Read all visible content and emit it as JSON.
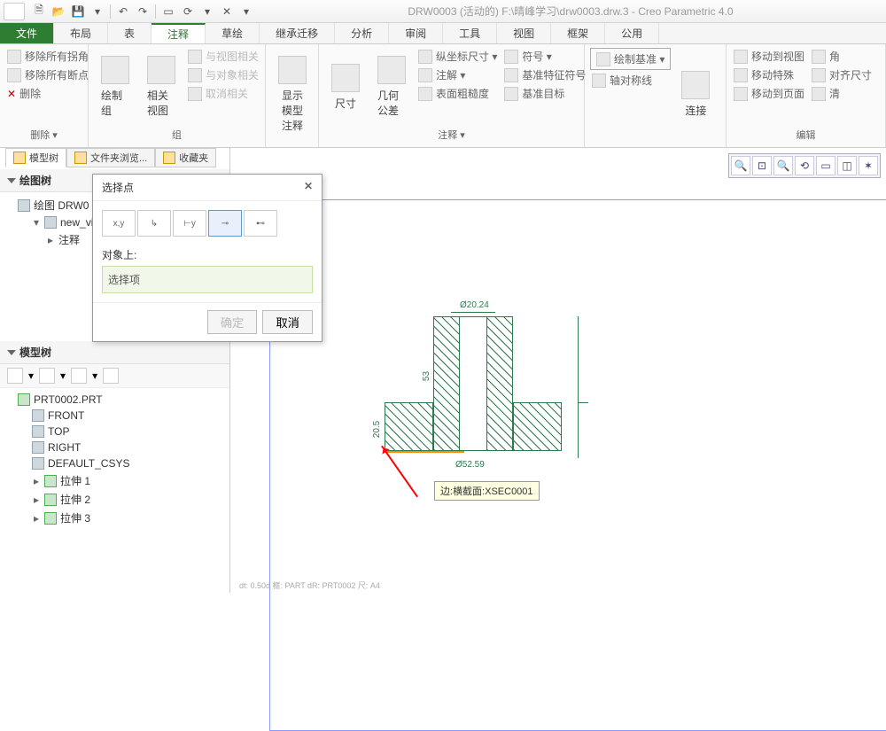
{
  "title": "DRW0003 (活动的) F:\\晴峰学习\\drw0003.drw.3 - Creo Parametric 4.0",
  "tabs": {
    "file": "文件",
    "items": [
      "布局",
      "表",
      "注释",
      "草绘",
      "继承迁移",
      "分析",
      "审阅",
      "工具",
      "视图",
      "框架",
      "公用"
    ],
    "active": 2
  },
  "ribbon": {
    "delete": {
      "label": "删除 ▾",
      "items": [
        "移除所有拐角",
        "移除所有断点",
        "删除"
      ]
    },
    "group": {
      "label": "组",
      "main1": "绘制组",
      "main2": "相关视图",
      "items": [
        "与视图相关",
        "与对象相关",
        "取消相关"
      ]
    },
    "anno_model": {
      "btn": "显示模型\n注释"
    },
    "dim": {
      "b1": "尺寸",
      "b2": "几何公差"
    },
    "annotate": {
      "label": "注释 ▾",
      "items": [
        "纵坐标尺寸 ▾",
        "注解 ▾",
        "表面粗糙度",
        "符号 ▾",
        "基准特征符号",
        "基准目标"
      ],
      "datum_btn": "绘制基准 ▾",
      "axis": "轴对称线"
    },
    "conn": {
      "btn": "连接"
    },
    "edit": {
      "label": "编辑",
      "items": [
        "移动到视图",
        "移动特殊",
        "移动到页面"
      ],
      "right": [
        "角",
        "对齐尺寸",
        "清"
      ]
    }
  },
  "nav_tabs": [
    "模型树",
    "文件夹浏览...",
    "收藏夹"
  ],
  "drawing_tree": {
    "header": "绘图树",
    "root": "绘图 DRW0",
    "node": "new_vie",
    "child": "注释"
  },
  "model_tree": {
    "header": "模型树",
    "root": "PRT0002.PRT",
    "items": [
      "FRONT",
      "TOP",
      "RIGHT",
      "DEFAULT_CSYS",
      "拉伸 1",
      "拉伸 2",
      "拉伸 3"
    ]
  },
  "dialog": {
    "title": "选择点",
    "label": "对象上:",
    "placeholder": "选择项",
    "ok": "确定",
    "cancel": "取消"
  },
  "drawing": {
    "d1": "Ø20.24",
    "d2": "53",
    "d3": "20.5",
    "d4": "Ø52.59"
  },
  "tooltip": "边:横截面:XSEC0001",
  "status": "dt: 0.50d  框: PART  dR: PRT0002  尺: A4"
}
